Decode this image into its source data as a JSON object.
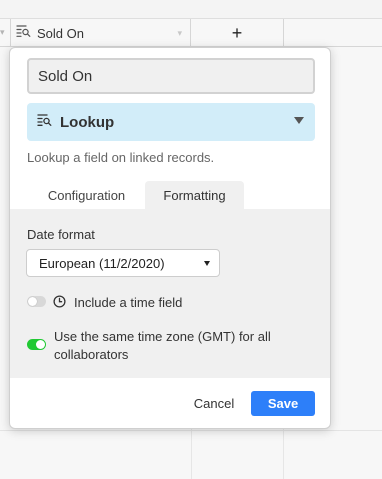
{
  "header": {
    "field_name": "Sold On",
    "field_icon": "lookup-icon",
    "add_field_icon": "plus-icon",
    "add_field_label": "+"
  },
  "popover": {
    "name_input_value": "Sold On",
    "field_type": {
      "label": "Lookup",
      "icon": "lookup-icon",
      "background_color": "#d2edf9"
    },
    "description": "Lookup a field on linked records.",
    "tabs": [
      {
        "label": "Configuration",
        "active": false
      },
      {
        "label": "Formatting",
        "active": true
      }
    ],
    "formatting": {
      "date_format_label": "Date format",
      "date_format_selected": "European (11/2/2020)",
      "include_time": {
        "label": "Include a time field",
        "enabled": false,
        "icon": "clock-icon"
      },
      "same_timezone": {
        "label": "Use the same time zone (GMT) for all collaborators",
        "enabled": true,
        "toggle_color": "#20c933"
      }
    },
    "actions": {
      "cancel_label": "Cancel",
      "save_label": "Save",
      "save_color": "#2d7ff9"
    }
  }
}
